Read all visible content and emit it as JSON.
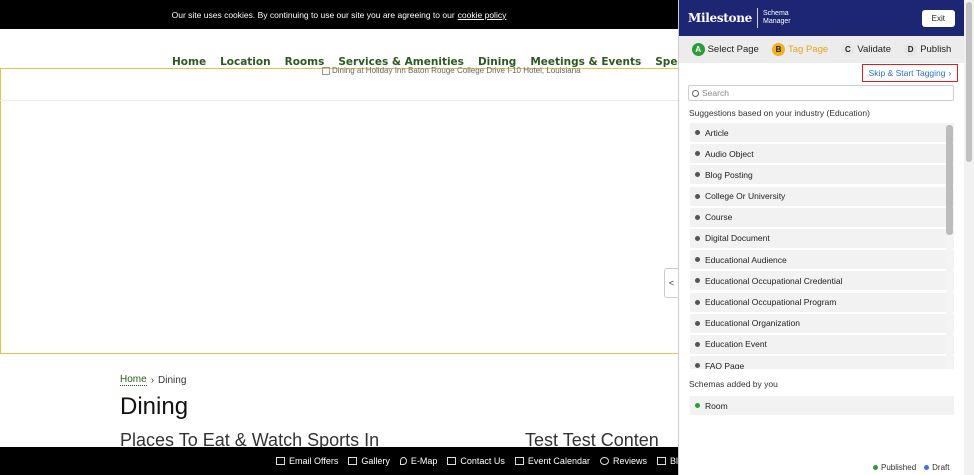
{
  "cookie": {
    "text": "Our site uses cookies. By continuing to use our site you are agreeing to our",
    "link": "cookie policy"
  },
  "nav": {
    "items": [
      "Home",
      "Location",
      "Rooms",
      "Services & Amenities",
      "Dining",
      "Meetings & Events",
      "Specials & Pack"
    ],
    "active": "Dining"
  },
  "hero": {
    "alt_text": "Dining at Holiday Inn Baton Rouge College Drive I-10 Hotel, Louisiana"
  },
  "breadcrumb": {
    "home": "Home",
    "separator": "›",
    "current": "Dining"
  },
  "page": {
    "title": "Dining",
    "subtitle": "Places To Eat & Watch Sports In",
    "subtitle2": "Test Test Conten"
  },
  "footer": {
    "items": [
      "Email Offers",
      "Gallery",
      "E-Map",
      "Contact Us",
      "Event Calendar",
      "Reviews",
      "Bl"
    ]
  },
  "toggle_label": "<",
  "panel": {
    "logo": "Milestone",
    "logo_sub_1": "Schema",
    "logo_sub_2": "Manager",
    "exit": "Exit",
    "steps": [
      {
        "badge": "A",
        "label": "Select Page"
      },
      {
        "badge": "B",
        "label": "Tag Page"
      },
      {
        "badge": "C",
        "label": "Validate"
      },
      {
        "badge": "D",
        "label": "Publish"
      }
    ],
    "skip_label": "Skip & Start Tagging",
    "skip_chevron": "›",
    "search_placeholder": "Search",
    "suggestions_label": "Suggestions based on your industry (Education)",
    "suggestions": [
      "Article",
      "Audio Object",
      "Blog Posting",
      "College Or University",
      "Course",
      "Digital Document",
      "Educational Audience",
      "Educational Occupational Credential",
      "Educational Occupational Program",
      "Educational Organization",
      "Education Event",
      "FAQ Page"
    ],
    "added_label": "Schemas added by you",
    "added": [
      "Room"
    ],
    "legend_published": "Published",
    "legend_draft": "Draft",
    "colors": {
      "header": "#1c2673",
      "published": "#2e9b3a",
      "draft": "#3a78d8",
      "highlight": "#e01e1e"
    }
  }
}
